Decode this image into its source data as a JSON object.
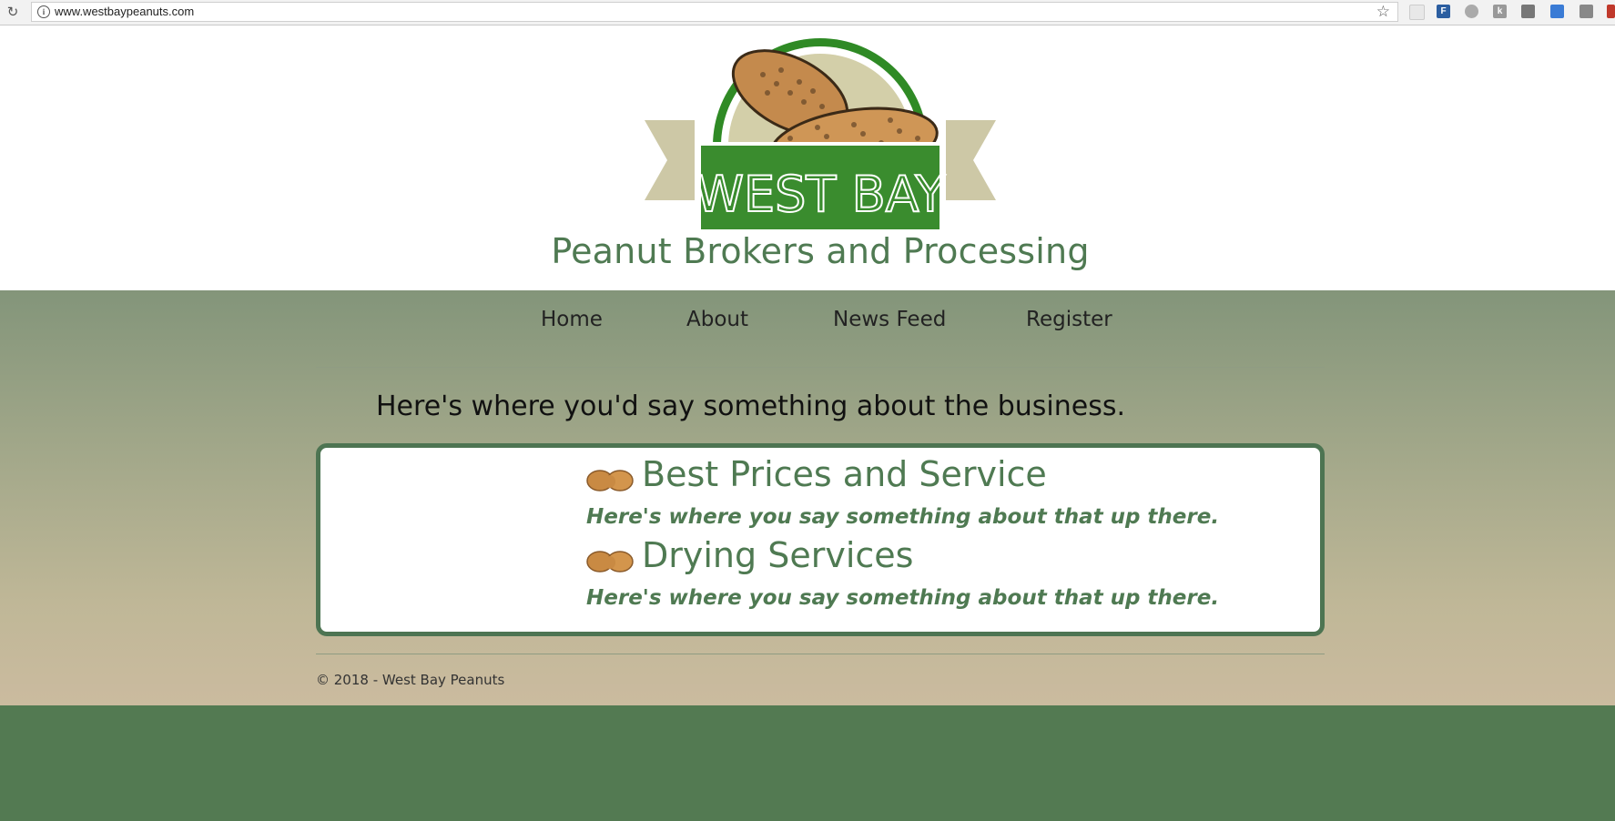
{
  "browser": {
    "url": "www.westbaypeanuts.com"
  },
  "header": {
    "logo_text": "WEST BAY",
    "tagline": "Peanut Brokers and Processing"
  },
  "nav": {
    "items": [
      {
        "label": "Home"
      },
      {
        "label": "About"
      },
      {
        "label": "News Feed"
      },
      {
        "label": "Register"
      }
    ]
  },
  "main": {
    "intro": "Here's where you'd say something about the business.",
    "services": [
      {
        "title": "Best Prices and Service",
        "description": "Here's where you say something about that up there."
      },
      {
        "title": "Drying Services",
        "description": "Here's where you say something about that up there."
      }
    ]
  },
  "footer": {
    "copyright": "© 2018 - West Bay Peanuts"
  },
  "colors": {
    "brand_green": "#4f7a52",
    "logo_green": "#3a8c2e",
    "bottom_green": "#537a52"
  }
}
